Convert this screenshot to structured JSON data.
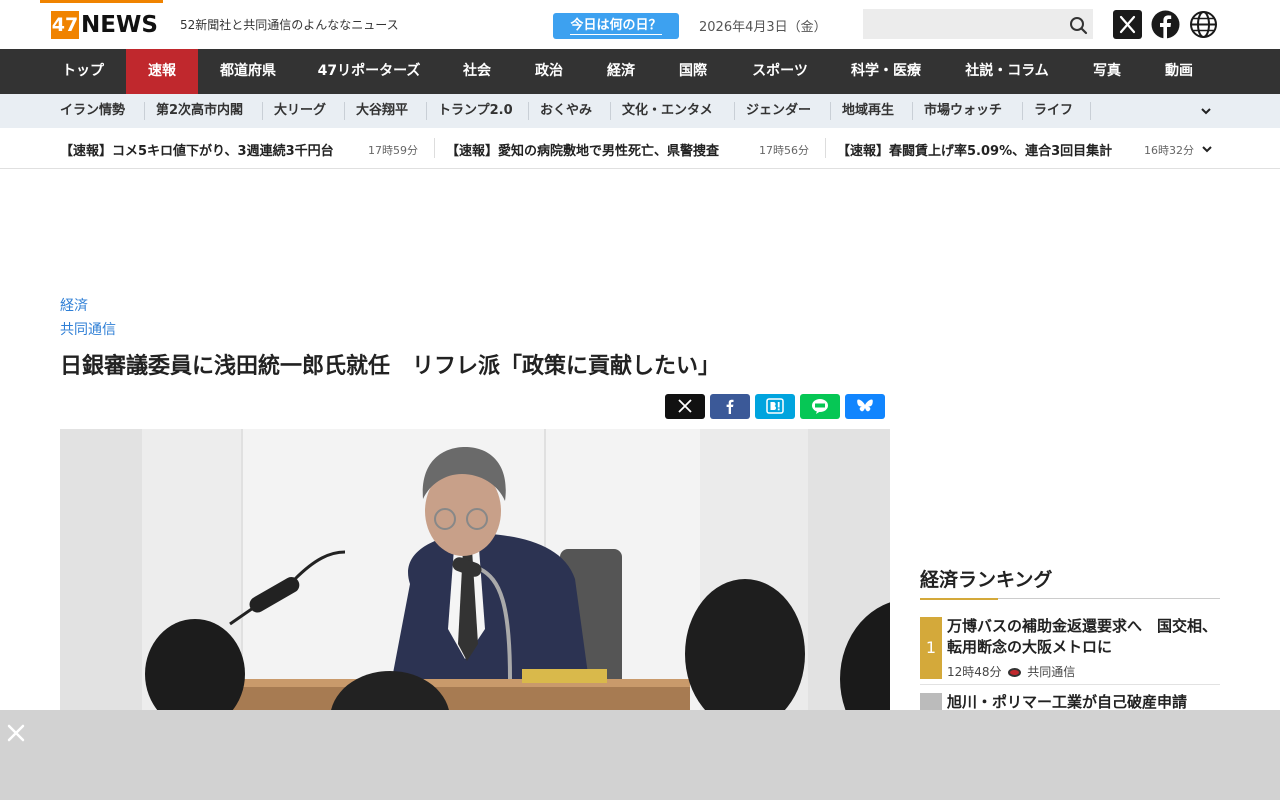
{
  "header": {
    "logo_num": "47",
    "logo_word": "NEWS",
    "tagline": "52新聞社と共同通信のよんななニュース",
    "today_button": "今日は何の日？",
    "date": "2026年4月3日（金）",
    "search_placeholder": ""
  },
  "mainnav": [
    {
      "label": "トップ"
    },
    {
      "label": "速報",
      "active": true
    },
    {
      "label": "都道府県"
    },
    {
      "label": "47リポーターズ"
    },
    {
      "label": "社会"
    },
    {
      "label": "政治"
    },
    {
      "label": "経済"
    },
    {
      "label": "国際"
    },
    {
      "label": "スポーツ"
    },
    {
      "label": "科学・医療"
    },
    {
      "label": "社説・コラム"
    },
    {
      "label": "写真"
    },
    {
      "label": "動画"
    }
  ],
  "subnav": [
    {
      "label": "イラン情勢"
    },
    {
      "label": "第2次高市内閣"
    },
    {
      "label": "大リーグ"
    },
    {
      "label": "大谷翔平"
    },
    {
      "label": "トランプ2.0"
    },
    {
      "label": "おくやみ"
    },
    {
      "label": "文化・エンタメ"
    },
    {
      "label": "ジェンダー"
    },
    {
      "label": "地域再生"
    },
    {
      "label": "市場ウォッチ"
    },
    {
      "label": "ライフ"
    }
  ],
  "ticker": [
    {
      "title": "【速報】コメ5キロ値下がり、3週連続3千円台",
      "time": "17時59分"
    },
    {
      "title": "【速報】愛知の病院敷地で男性死亡、県警捜査",
      "time": "17時56分"
    },
    {
      "title": "【速報】春闘賃上げ率5.09%、連合3回目集計",
      "time": "16時32分"
    }
  ],
  "article": {
    "category": "経済",
    "source": "共同通信",
    "headline": "日銀審議委員に浅田統一郎氏就任　リフレ派「政策に貢献したい」"
  },
  "share_buttons": [
    {
      "name": "x",
      "color": "#111111"
    },
    {
      "name": "facebook",
      "color": "#3b5998"
    },
    {
      "name": "hatena",
      "color": "#00a4de"
    },
    {
      "name": "line",
      "color": "#06c755"
    },
    {
      "name": "bluesky",
      "color": "#1185fe"
    }
  ],
  "ranking": {
    "title": "経済ランキング",
    "items": [
      {
        "rank": "1",
        "title": "万博バスの補助金返還要求へ　国交相、転用断念の大阪メトロに",
        "time": "12時48分",
        "source": "共同通信"
      },
      {
        "rank": "",
        "title": "旭川・ポリマー工業が自己破産申請"
      }
    ]
  },
  "colors": {
    "accent": "#f08300",
    "nav_bg": "#333333",
    "nav_active": "#c0282d",
    "subnav_bg": "#e9eef3",
    "link": "#2f7fd6",
    "rank_gold": "#d4a93a"
  }
}
